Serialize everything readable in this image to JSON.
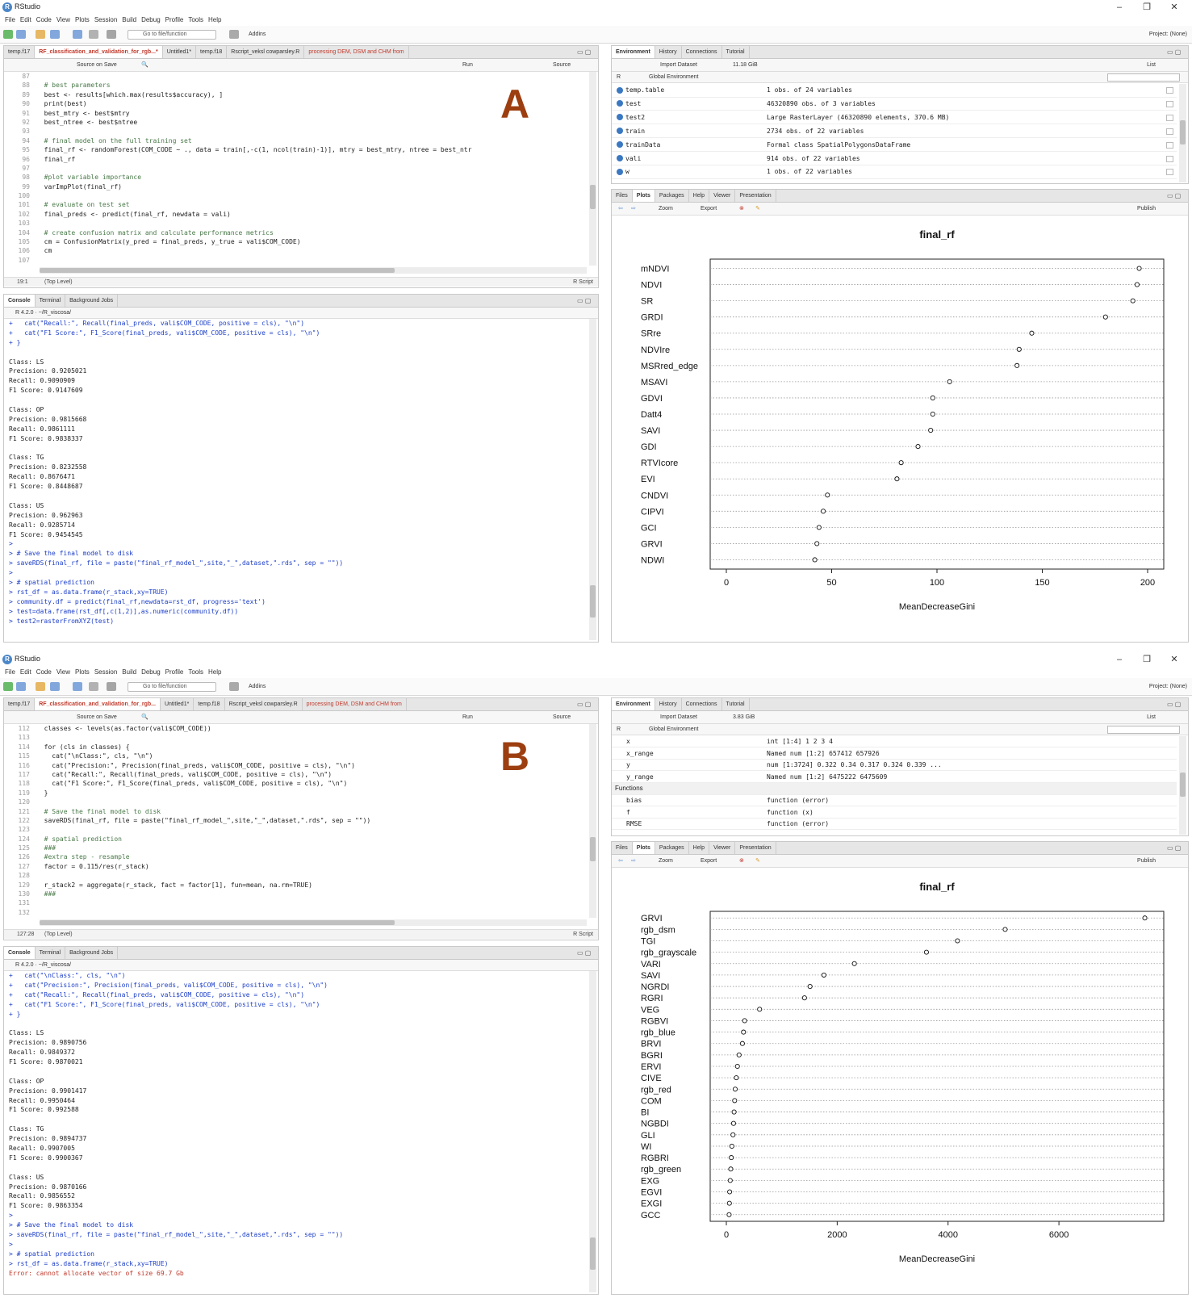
{
  "window_title": "RStudio",
  "menu": [
    "File",
    "Edit",
    "Code",
    "View",
    "Plots",
    "Session",
    "Build",
    "Debug",
    "Profile",
    "Tools",
    "Help"
  ],
  "toolbar": {
    "goto": "Go to file/function",
    "addins": "Addins",
    "project": "Project: (None)"
  },
  "env_tabs": [
    "Environment",
    "History",
    "Connections",
    "Tutorial"
  ],
  "plot_tabs": [
    "Files",
    "Plots",
    "Packages",
    "Help",
    "Viewer",
    "Presentation"
  ],
  "console_tabs": [
    "Console",
    "Terminal",
    "Background Jobs"
  ],
  "editor_labels": {
    "source_on_save": "Source on Save",
    "run": "Run",
    "source": "Source",
    "r_script": "R Script",
    "top_level": "(Top Level)"
  },
  "env_labels": {
    "import_dataset": "Import Dataset",
    "list": "List",
    "r": "R",
    "global_env": "Global Environment",
    "zoom": "Zoom",
    "export": "Export",
    "publish": "Publish"
  },
  "console_header": "R 4.2.0 · ~/R_viscosa/",
  "A": {
    "label": "A",
    "editor_tabs": [
      "temp.f17",
      "RF_classification_and_validation_for_rgb...*",
      "Untitled1*",
      "temp.f18",
      "Rscript_veksl cowparsley.R",
      "processing DEM, DSM and CHM from"
    ],
    "mem": "11.18 GiB",
    "cursor": "19:1",
    "code": [
      {
        "n": "87",
        "t": ""
      },
      {
        "n": "88",
        "t": "  # best parameters",
        "c": true
      },
      {
        "n": "89",
        "t": "  best <- results[which.max(results$accuracy), ]"
      },
      {
        "n": "90",
        "t": "  print(best)"
      },
      {
        "n": "91",
        "t": "  best_mtry <- best$mtry"
      },
      {
        "n": "92",
        "t": "  best_ntree <- best$ntree"
      },
      {
        "n": "93",
        "t": ""
      },
      {
        "n": "94",
        "t": "  # final model on the full training set",
        "c": true
      },
      {
        "n": "95",
        "t": "  final_rf <- randomForest(COM_CODE ~ ., data = train[,-c(1, ncol(train)-1)], mtry = best_mtry, ntree = best_ntr"
      },
      {
        "n": "96",
        "t": "  final_rf"
      },
      {
        "n": "97",
        "t": ""
      },
      {
        "n": "98",
        "t": "  #plot variable importance",
        "c": true
      },
      {
        "n": "99",
        "t": "  varImpPlot(final_rf)"
      },
      {
        "n": "100",
        "t": ""
      },
      {
        "n": "101",
        "t": "  # evaluate on test set",
        "c": true
      },
      {
        "n": "102",
        "t": "  final_preds <- predict(final_rf, newdata = vali)"
      },
      {
        "n": "103",
        "t": ""
      },
      {
        "n": "104",
        "t": "  # create confusion matrix and calculate performance metrics",
        "c": true
      },
      {
        "n": "105",
        "t": "  cm = ConfusionMatrix(y_pred = final_preds, y_true = vali$COM_CODE)"
      },
      {
        "n": "106",
        "t": "  cm"
      },
      {
        "n": "107",
        "t": ""
      }
    ],
    "console": [
      {
        "t": "+   cat(\"Recall:\", Recall(final_preds, vali$COM_CODE, positive = cls), \"\\n\")",
        "k": "b"
      },
      {
        "t": "+   cat(\"F1 Score:\", F1_Score(final_preds, vali$COM_CODE, positive = cls), \"\\n\")",
        "k": "b"
      },
      {
        "t": "+ }",
        "k": "b"
      },
      {
        "t": ""
      },
      {
        "t": "Class: LS"
      },
      {
        "t": "Precision: 0.9205021"
      },
      {
        "t": "Recall: 0.9090909"
      },
      {
        "t": "F1 Score: 0.9147609"
      },
      {
        "t": ""
      },
      {
        "t": "Class: OP"
      },
      {
        "t": "Precision: 0.9815668"
      },
      {
        "t": "Recall: 0.9861111"
      },
      {
        "t": "F1 Score: 0.9838337"
      },
      {
        "t": ""
      },
      {
        "t": "Class: TG"
      },
      {
        "t": "Precision: 0.8232558"
      },
      {
        "t": "Recall: 0.8676471"
      },
      {
        "t": "F1 Score: 0.8448687"
      },
      {
        "t": ""
      },
      {
        "t": "Class: US"
      },
      {
        "t": "Precision: 0.962963"
      },
      {
        "t": "Recall: 0.9285714"
      },
      {
        "t": "F1 Score: 0.9454545"
      },
      {
        "t": ">",
        "k": "b"
      },
      {
        "t": "> # Save the final model to disk",
        "k": "b"
      },
      {
        "t": "> saveRDS(final_rf, file = paste(\"final_rf_model_\",site,\"_\",dataset,\".rds\", sep = \"\"))",
        "k": "b"
      },
      {
        "t": ">",
        "k": "b"
      },
      {
        "t": "> # spatial prediction",
        "k": "b"
      },
      {
        "t": "> rst_df = as.data.frame(r_stack,xy=TRUE)",
        "k": "b"
      },
      {
        "t": "> community.df = predict(final_rf,newdata=rst_df, progress='text')",
        "k": "b"
      },
      {
        "t": "> test=data.frame(rst_df[,c(1,2)],as.numeric(community.df))",
        "k": "b"
      },
      {
        "t": "> test2=rasterFromXYZ(test)",
        "k": "b"
      }
    ],
    "env": [
      {
        "name": "temp.table",
        "val": "1 obs. of 24 variables"
      },
      {
        "name": "test",
        "val": "46320890 obs. of 3 variables"
      },
      {
        "name": "test2",
        "val": "Large RasterLayer (46320890 elements, 370.6 MB)"
      },
      {
        "name": "train",
        "val": "2734 obs. of 22 variables"
      },
      {
        "name": "trainData",
        "val": "Formal class  SpatialPolygonsDataFrame"
      },
      {
        "name": "vali",
        "val": "914 obs. of 22 variables"
      },
      {
        "name": "w",
        "val": "1 obs. of 22 variables"
      }
    ]
  },
  "B": {
    "label": "B",
    "editor_tabs": [
      "temp.f17",
      "RF_classification_and_validation_for_rgb...",
      "Untitled1*",
      "temp.f18",
      "Rscript_veksl cowparsley.R",
      "processing DEM, DSM and CHM from"
    ],
    "mem": "3.83 GiB",
    "cursor": "127:28",
    "code": [
      {
        "n": "112",
        "t": "  classes <- levels(as.factor(vali$COM_CODE))"
      },
      {
        "n": "113",
        "t": ""
      },
      {
        "n": "114",
        "t": "  for (cls in classes) {"
      },
      {
        "n": "115",
        "t": "    cat(\"\\nClass:\", cls, \"\\n\")"
      },
      {
        "n": "116",
        "t": "    cat(\"Precision:\", Precision(final_preds, vali$COM_CODE, positive = cls), \"\\n\")"
      },
      {
        "n": "117",
        "t": "    cat(\"Recall:\", Recall(final_preds, vali$COM_CODE, positive = cls), \"\\n\")"
      },
      {
        "n": "118",
        "t": "    cat(\"F1 Score:\", F1_Score(final_preds, vali$COM_CODE, positive = cls), \"\\n\")"
      },
      {
        "n": "119",
        "t": "  }"
      },
      {
        "n": "120",
        "t": ""
      },
      {
        "n": "121",
        "t": "  # Save the final model to disk",
        "c": true
      },
      {
        "n": "122",
        "t": "  saveRDS(final_rf, file = paste(\"final_rf_model_\",site,\"_\",dataset,\".rds\", sep = \"\"))"
      },
      {
        "n": "123",
        "t": ""
      },
      {
        "n": "124",
        "t": "  # spatial prediction",
        "c": true
      },
      {
        "n": "125",
        "t": "  ###",
        "c": true
      },
      {
        "n": "126",
        "t": "  #extra step - resample",
        "c": true
      },
      {
        "n": "127",
        "t": "  factor = 0.115/res(r_stack)"
      },
      {
        "n": "128",
        "t": ""
      },
      {
        "n": "129",
        "t": "  r_stack2 = aggregate(r_stack, fact = factor[1], fun=mean, na.rm=TRUE)"
      },
      {
        "n": "130",
        "t": "  ###",
        "c": true
      },
      {
        "n": "131",
        "t": ""
      },
      {
        "n": "132",
        "t": ""
      }
    ],
    "console": [
      {
        "t": "+   cat(\"\\nClass:\", cls, \"\\n\")",
        "k": "b"
      },
      {
        "t": "+   cat(\"Precision:\", Precision(final_preds, vali$COM_CODE, positive = cls), \"\\n\")",
        "k": "b"
      },
      {
        "t": "+   cat(\"Recall:\", Recall(final_preds, vali$COM_CODE, positive = cls), \"\\n\")",
        "k": "b"
      },
      {
        "t": "+   cat(\"F1 Score:\", F1_Score(final_preds, vali$COM_CODE, positive = cls), \"\\n\")",
        "k": "b"
      },
      {
        "t": "+ }",
        "k": "b"
      },
      {
        "t": ""
      },
      {
        "t": "Class: LS"
      },
      {
        "t": "Precision: 0.9890756"
      },
      {
        "t": "Recall: 0.9849372"
      },
      {
        "t": "F1 Score: 0.9870021"
      },
      {
        "t": ""
      },
      {
        "t": "Class: OP"
      },
      {
        "t": "Precision: 0.9901417"
      },
      {
        "t": "Recall: 0.9950464"
      },
      {
        "t": "F1 Score: 0.992588"
      },
      {
        "t": ""
      },
      {
        "t": "Class: TG"
      },
      {
        "t": "Precision: 0.9894737"
      },
      {
        "t": "Recall: 0.9907005"
      },
      {
        "t": "F1 Score: 0.9900367"
      },
      {
        "t": ""
      },
      {
        "t": "Class: US"
      },
      {
        "t": "Precision: 0.9870166"
      },
      {
        "t": "Recall: 0.9856552"
      },
      {
        "t": "F1 Score: 0.9863354"
      },
      {
        "t": ">",
        "k": "b"
      },
      {
        "t": "> # Save the final model to disk",
        "k": "b"
      },
      {
        "t": "> saveRDS(final_rf, file = paste(\"final_rf_model_\",site,\"_\",dataset,\".rds\", sep = \"\"))",
        "k": "b"
      },
      {
        "t": ">",
        "k": "b"
      },
      {
        "t": "> # spatial prediction",
        "k": "b"
      },
      {
        "t": "> rst_df = as.data.frame(r_stack,xy=TRUE)",
        "k": "b"
      },
      {
        "t": "Error: cannot allocate vector of size 69.7 Gb",
        "k": "e"
      }
    ],
    "env": [
      {
        "name": "x",
        "val": "int [1:4] 1 2 3 4"
      },
      {
        "name": "x_range",
        "val": "Named num [1:2] 657412 657926"
      },
      {
        "name": "y",
        "val": "num [1:3724] 0.322 0.34 0.317 0.324 0.339 ..."
      },
      {
        "name": "y_range",
        "val": "Named num [1:2] 6475222 6475609"
      },
      {
        "name": "Functions",
        "val": "",
        "hdr": true
      },
      {
        "name": "bias",
        "val": "function (error)"
      },
      {
        "name": "f",
        "val": "function (x)"
      },
      {
        "name": "RMSE",
        "val": "function (error)"
      }
    ]
  },
  "chart_data": [
    {
      "type": "scatter",
      "title": "final_rf",
      "xlabel": "MeanDecreaseGini",
      "ylabel": "",
      "xlim": [
        0,
        200
      ],
      "xticks": [
        0,
        50,
        100,
        150,
        200
      ],
      "grid": "dotted horizontal lines",
      "categories": [
        "mNDVI",
        "NDVI",
        "SR",
        "GRDI",
        "SRre",
        "NDVIre",
        "MSRred_edge",
        "MSAVI",
        "GDVI",
        "Datt4",
        "SAVI",
        "GDI",
        "RTVIcore",
        "EVI",
        "CNDVI",
        "CIPVI",
        "GCI",
        "GRVI",
        "NDWI"
      ],
      "values": [
        196,
        195,
        193,
        180,
        145,
        139,
        138,
        106,
        98,
        98,
        97,
        91,
        83,
        81,
        48,
        46,
        44,
        43,
        42
      ]
    },
    {
      "type": "scatter",
      "title": "final_rf",
      "xlabel": "MeanDecreaseGini",
      "ylabel": "",
      "xlim": [
        0,
        7600
      ],
      "xticks": [
        0,
        2000,
        4000,
        6000
      ],
      "grid": "dotted horizontal lines",
      "categories": [
        "GRVI",
        "rgb_dsm",
        "TGI",
        "rgb_grayscale",
        "VARI",
        "SAVI",
        "NGRDI",
        "RGRI",
        "VEG",
        "RGBVI",
        "rgb_blue",
        "BRVI",
        "BGRI",
        "ERVI",
        "CIVE",
        "rgb_red",
        "COM",
        "BI",
        "NGBDI",
        "GLI",
        "WI",
        "RGBRI",
        "rgb_green",
        "EXG",
        "EGVI",
        "EXGI",
        "GCC"
      ],
      "values": [
        7550,
        5030,
        4170,
        3610,
        2310,
        1760,
        1510,
        1410,
        600,
        330,
        310,
        290,
        230,
        200,
        180,
        160,
        150,
        140,
        130,
        120,
        100,
        90,
        80,
        70,
        60,
        55,
        50
      ]
    }
  ]
}
